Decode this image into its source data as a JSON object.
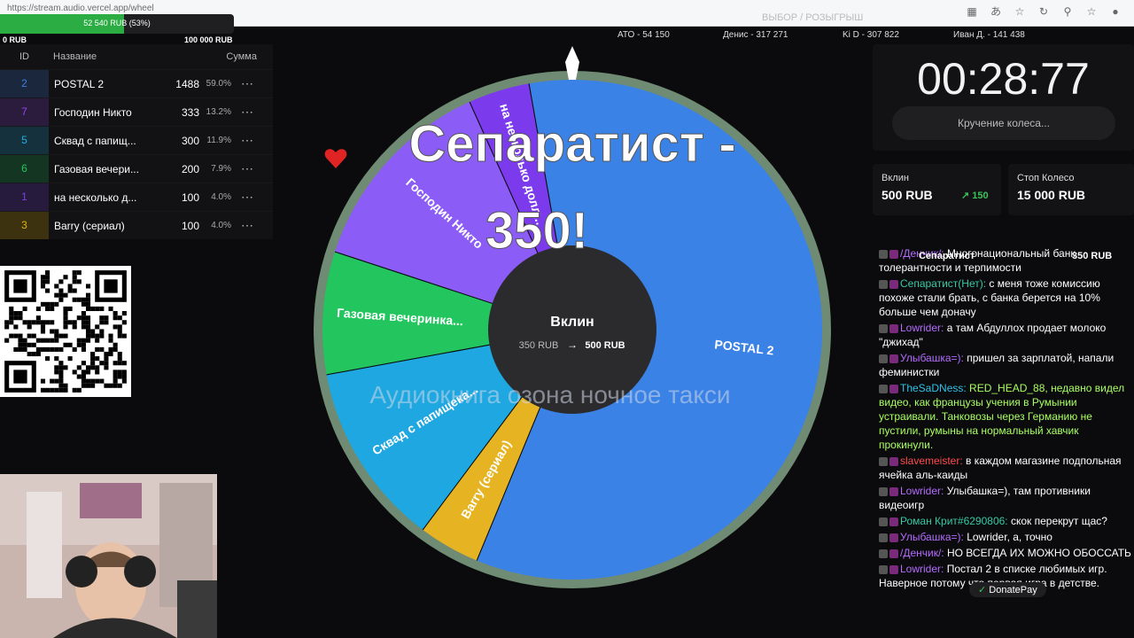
{
  "browser": {
    "url": "https://stream.audio.vercel.app/wheel",
    "overlay_text": "ВЫБОР / РОЗЫГРЫШ"
  },
  "goal": {
    "label": "52 540 RUB (53%)",
    "fraction": 0.53,
    "min": "0 RUB",
    "max": "100 000 RUB"
  },
  "table": {
    "headers": {
      "id": "ID",
      "name": "Название",
      "amount": "Сумма"
    },
    "rows": [
      {
        "id": "2",
        "name": "POSTAL 2",
        "amount": "1488",
        "pct": "59.0%",
        "color": "#3d7fe3",
        "more": "⋯"
      },
      {
        "id": "7",
        "name": "Господин Никто",
        "amount": "333",
        "pct": "13.2%",
        "color": "#8f47e8",
        "more": "⋯"
      },
      {
        "id": "5",
        "name": "Сквад с папищ...",
        "amount": "300",
        "pct": "11.9%",
        "color": "#1fb0e0",
        "more": "⋯"
      },
      {
        "id": "6",
        "name": "Газовая вечери...",
        "amount": "200",
        "pct": "7.9%",
        "color": "#22c55e",
        "more": "⋯"
      },
      {
        "id": "1",
        "name": "на несколько д...",
        "amount": "100",
        "pct": "4.0%",
        "color": "#7b3fe0",
        "more": "⋯"
      },
      {
        "id": "3",
        "name": "Barry (сериал)",
        "amount": "100",
        "pct": "4.0%",
        "color": "#e5b400",
        "more": "⋯"
      }
    ]
  },
  "top_donors": [
    {
      "text": "АТО - 54 150"
    },
    {
      "text": "Денис - 317 271"
    },
    {
      "text": "Ki D - 307 822"
    },
    {
      "text": "Иван Д. - 141 438"
    }
  ],
  "wheel": {
    "winner_text_line1": "Сепаратист -",
    "winner_text_line2": "350!",
    "center_title": "Вклин",
    "center_from": "350 RUB",
    "center_arrow": "→",
    "center_to": "500 RUB",
    "subtitle_overlay": "Аудиокнига озона ночное такси",
    "segments": [
      {
        "label": "POSTAL 2",
        "value": 1488,
        "color": "#3b82e6"
      },
      {
        "label": "Barry (сериал)",
        "value": 100,
        "color": "#e6b422"
      },
      {
        "label": "Сквад с папищека...",
        "value": 300,
        "color": "#1ea7e0"
      },
      {
        "label": "Газовая вечеринка...",
        "value": 200,
        "color": "#22c55e"
      },
      {
        "label": "Господин Никто",
        "value": 333,
        "color": "#8b5cf6"
      },
      {
        "label": "на несколько долл...",
        "value": 100,
        "color": "#7c3aed"
      }
    ]
  },
  "timer": {
    "value": "00:28:77",
    "spin_label": "Кручение колеса..."
  },
  "vklin": {
    "label": "Вклин",
    "value": "500 RUB",
    "increment": "150"
  },
  "stop": {
    "label": "Стоп Колесо",
    "value": "15 000 RUB"
  },
  "donation_popup": {
    "name": "Сепаратист",
    "amount": "350 RUB"
  },
  "chat": [
    {
      "nick": "/Денчик/:",
      "color": "#b46cff",
      "text": " Многонациональный банк толерантности и терпимости"
    },
    {
      "nick": "Сепаратист(Нет):",
      "color": "#36c9a6",
      "text": " с меня тоже комиссию похоже стали брать, с банка берется на 10% больше чем доначу"
    },
    {
      "nick": "Lowrider:",
      "color": "#b46cff",
      "text": " а там Абдуллох продает молоко \"джихад\""
    },
    {
      "nick": "Улыбашка=):",
      "color": "#b46cff",
      "text": " пришел за зарплатой, напали феминистки"
    },
    {
      "nick": "TheSaDNess:",
      "color": "#2ec3ea",
      "text": " RED_HEAD_88, недавно видел видео, как французы учения в Румынии устраивали. Танковозы через Германию не пустили, румыны на нормальный хавчик прокинули.",
      "text_color": "#a8ff60"
    },
    {
      "nick": "slavemeister:",
      "color": "#ff4d4d",
      "text": " в каждом магазине подпольная ячейка аль-каиды"
    },
    {
      "nick": "Lowrider:",
      "color": "#b46cff",
      "text": " Улыбашка=), там противники видеоигр"
    },
    {
      "nick": "Роман Крит#6290806:",
      "color": "#36c9a6",
      "text": " скок перекрут щас?"
    },
    {
      "nick": "Улыбашка=):",
      "color": "#b46cff",
      "text": " Lowrider, а, точно"
    },
    {
      "nick": "/Денчик/:",
      "color": "#b46cff",
      "text": " НО ВСЕГДА ИХ МОЖНО ОБОССАТЬ"
    },
    {
      "nick": "Lowrider:",
      "color": "#b46cff",
      "text": " Постал 2 в списке любимых игр. Наверное потому что первая игра в детстве."
    }
  ],
  "donatepay_label": "DonatePay"
}
